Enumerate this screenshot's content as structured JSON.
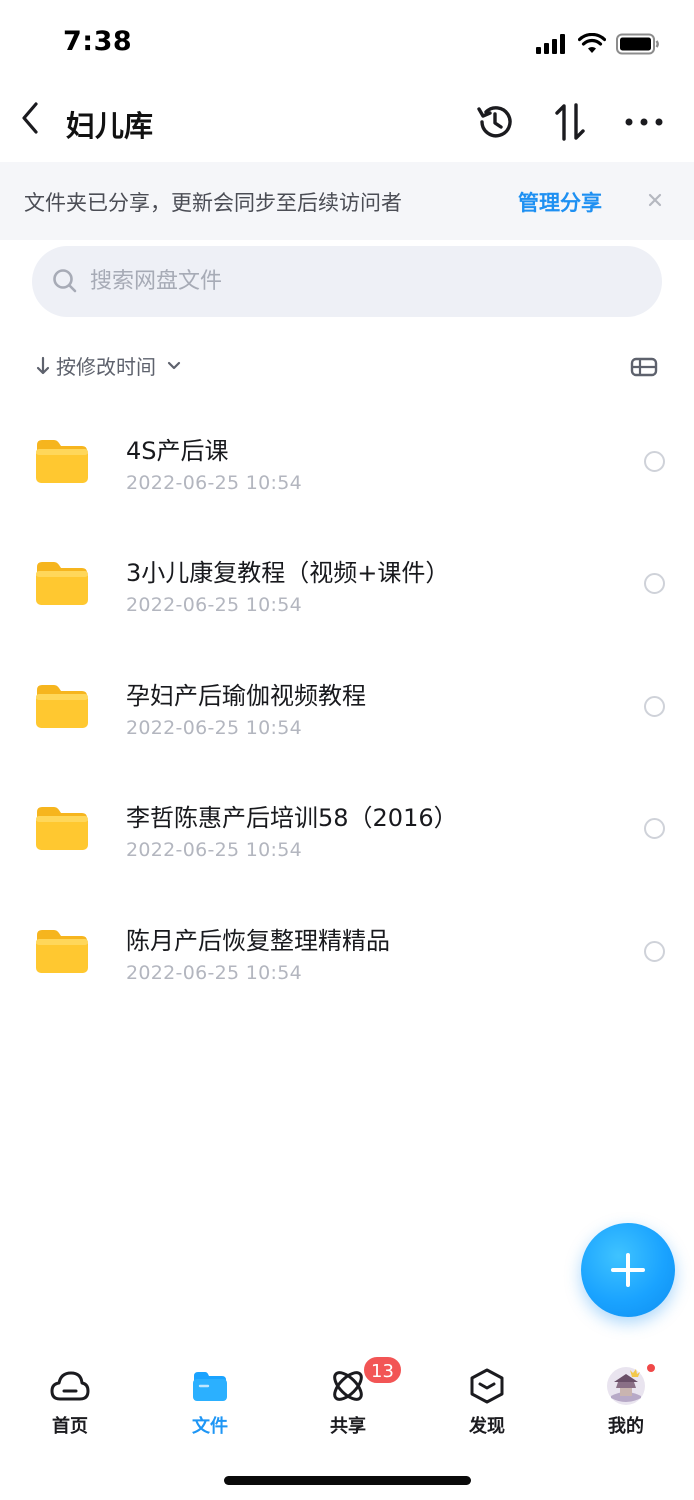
{
  "status_bar": {
    "time": "7:38"
  },
  "nav": {
    "title": "妇儿库"
  },
  "share_banner": {
    "message": "文件夹已分享，更新会同步至后续访问者",
    "action_label": "管理分享"
  },
  "search": {
    "placeholder": "搜索网盘文件"
  },
  "sort": {
    "label": "按修改时间"
  },
  "files": [
    {
      "name": "4S产后课",
      "date": "2022-06-25 10:54"
    },
    {
      "name": "3小儿康复教程（视频+课件）",
      "date": "2022-06-25 10:54"
    },
    {
      "name": "孕妇产后瑜伽视频教程",
      "date": "2022-06-25 10:54"
    },
    {
      "name": "李哲陈惠产后培训58（2016）",
      "date": "2022-06-25 10:54"
    },
    {
      "name": "陈月产后恢复整理精精品",
      "date": "2022-06-25 10:54"
    }
  ],
  "tabs": [
    {
      "label": "首页",
      "icon": "cloud-home-icon"
    },
    {
      "label": "文件",
      "icon": "folder-icon",
      "active": true
    },
    {
      "label": "共享",
      "icon": "share-orbit-icon",
      "badge": "13"
    },
    {
      "label": "发现",
      "icon": "cube-discover-icon"
    },
    {
      "label": "我的",
      "icon": "avatar-icon"
    }
  ],
  "colors": {
    "accent": "#1e96f5",
    "badge": "#f25555",
    "folder": "#ffc72c"
  }
}
